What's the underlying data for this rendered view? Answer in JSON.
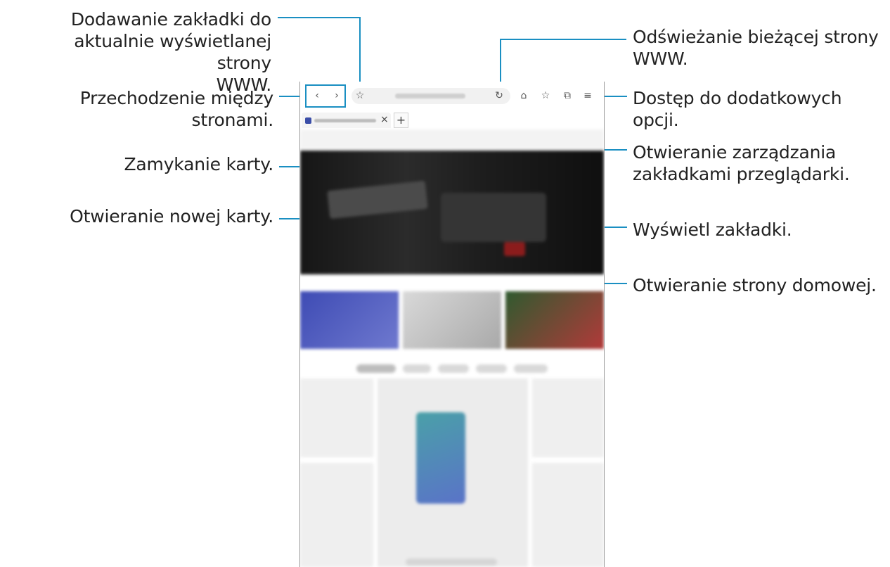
{
  "callouts": {
    "bookmark_add": "Dodawanie zakładki do\naktualnie wyświetlanej strony\nWWW.",
    "navigate": "Przechodzenie między stronami.",
    "close_tab": "Zamykanie karty.",
    "new_tab": "Otwieranie nowej karty.",
    "refresh": "Odświeżanie bieżącej strony\nWWW.",
    "more_options": "Dostęp do dodatkowych opcji.",
    "tab_manager": "Otwieranie zarządzania\nzakładkami przeglądarki.",
    "view_bookmarks": "Wyświetl zakładki.",
    "home": "Otwieranie strony domowej."
  },
  "browser": {
    "toolbar": {
      "back_icon": "‹",
      "forward_icon": "›",
      "bookmark_icon": "☆",
      "refresh_icon": "↻",
      "home_icon": "⌂",
      "bookmarks_icon": "☆",
      "tabs_icon": "⧉",
      "menu_icon": "≡"
    },
    "tab": {
      "close_icon": "×"
    },
    "new_tab_icon": "+"
  },
  "colors": {
    "accent": "#1a8fc2"
  }
}
